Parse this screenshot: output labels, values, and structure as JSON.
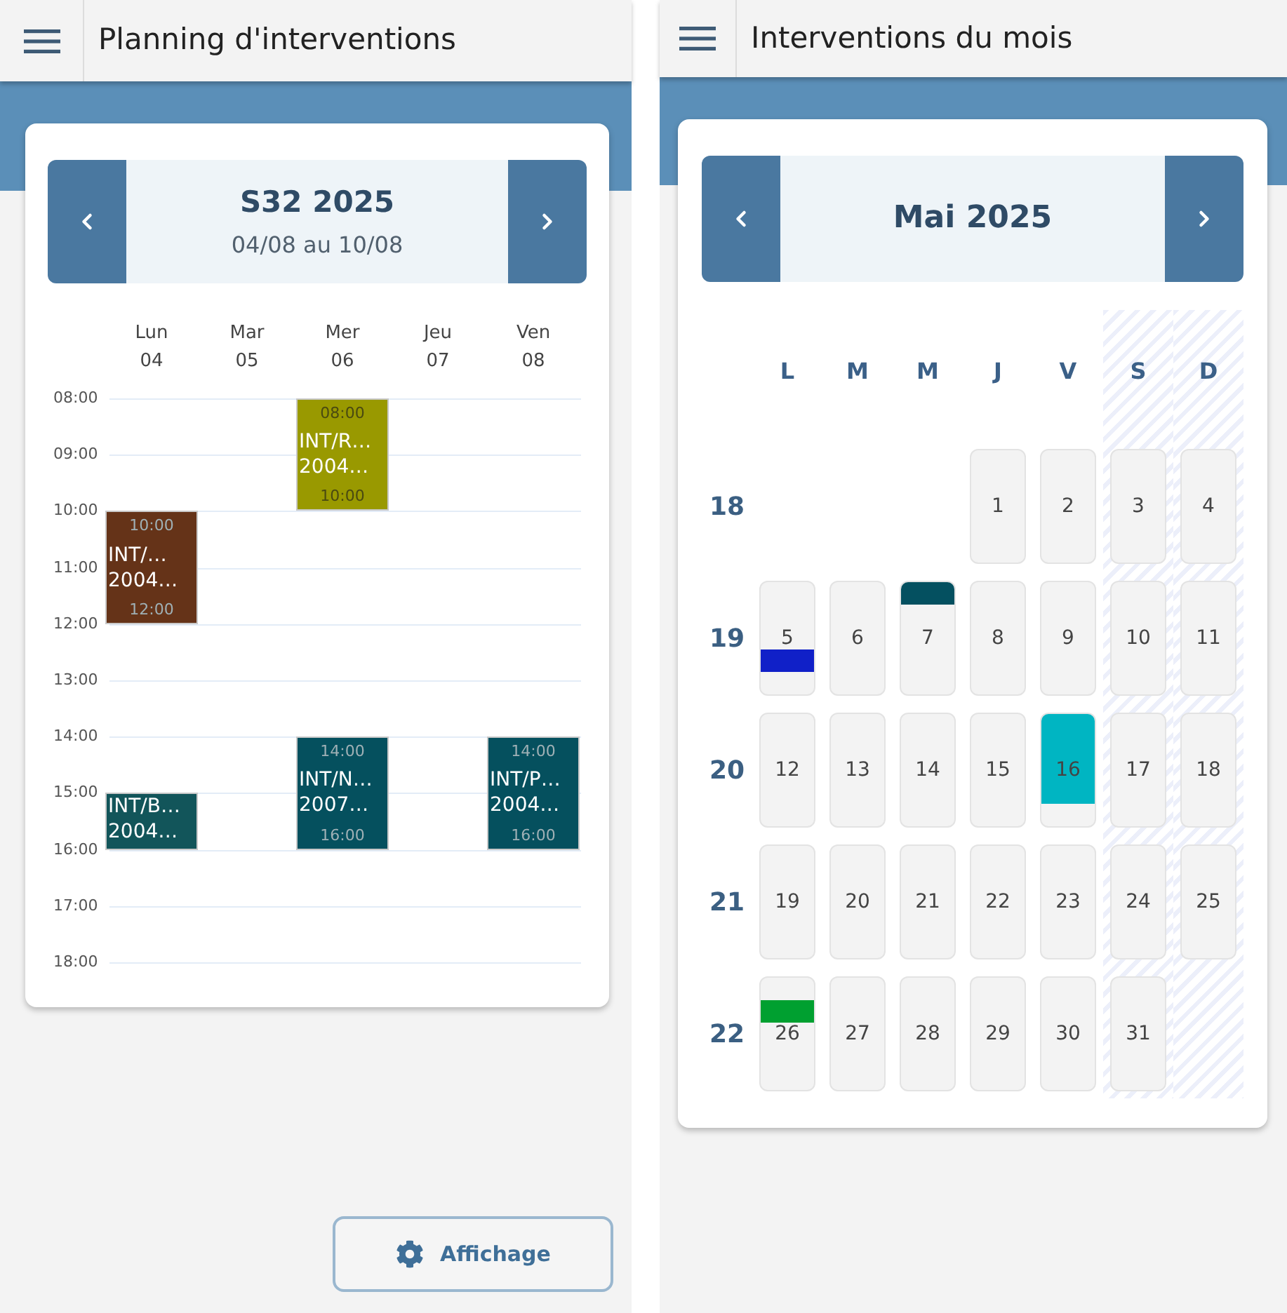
{
  "week_planning": {
    "header": {
      "title": "Planning d'interventions"
    },
    "navigation": {
      "title": "S32 2025",
      "subtitle": "04/08 au 10/08"
    },
    "hours": [
      "08:00",
      "09:00",
      "10:00",
      "11:00",
      "12:00",
      "13:00",
      "14:00",
      "15:00",
      "16:00",
      "17:00",
      "18:00"
    ],
    "days": [
      {
        "name": "Lun",
        "date": "04",
        "slots": [
          {
            "kind": "free"
          },
          {
            "kind": "free"
          },
          {
            "kind": "event",
            "start": "10:00",
            "title": "INT/…",
            "code": "2004…",
            "end": "12:00",
            "color": "#653318"
          },
          {
            "kind": "continued"
          },
          {
            "kind": "free"
          },
          {
            "kind": "free"
          },
          {
            "kind": "free"
          },
          {
            "kind": "event",
            "title": "INT/B…",
            "code": "2004…",
            "color": "#12555a"
          },
          {
            "kind": "free"
          },
          {
            "kind": "free"
          }
        ]
      },
      {
        "name": "Mar",
        "date": "05",
        "slots": [
          {
            "kind": "free"
          },
          {
            "kind": "free"
          },
          {
            "kind": "free"
          },
          {
            "kind": "free"
          },
          {
            "kind": "free"
          },
          {
            "kind": "free"
          },
          {
            "kind": "free"
          },
          {
            "kind": "free"
          },
          {
            "kind": "free"
          },
          {
            "kind": "free"
          }
        ]
      },
      {
        "name": "Mer",
        "date": "06",
        "slots": [
          {
            "kind": "event",
            "start": "08:00",
            "title": "INT/R…",
            "code": "2004…",
            "end": "10:00",
            "color": "#999900"
          },
          {
            "kind": "continued"
          },
          {
            "kind": "free"
          },
          {
            "kind": "free"
          },
          {
            "kind": "free"
          },
          {
            "kind": "free"
          },
          {
            "kind": "event",
            "start": "14:00",
            "title": "INT/N…",
            "code": "2007…",
            "end": "16:00",
            "color": "#05505e"
          },
          {
            "kind": "continued"
          },
          {
            "kind": "free"
          },
          {
            "kind": "free"
          }
        ]
      },
      {
        "name": "Jeu",
        "date": "07",
        "slots": [
          {
            "kind": "free"
          },
          {
            "kind": "free"
          },
          {
            "kind": "free"
          },
          {
            "kind": "free"
          },
          {
            "kind": "free"
          },
          {
            "kind": "free"
          },
          {
            "kind": "free"
          },
          {
            "kind": "free"
          },
          {
            "kind": "free"
          },
          {
            "kind": "free"
          }
        ]
      },
      {
        "name": "Ven",
        "date": "08",
        "slots": [
          {
            "kind": "free"
          },
          {
            "kind": "free"
          },
          {
            "kind": "free"
          },
          {
            "kind": "free"
          },
          {
            "kind": "free"
          },
          {
            "kind": "free"
          },
          {
            "kind": "event",
            "start": "14:00",
            "title": "INT/P…",
            "code": "2004…",
            "end": "16:00",
            "color": "#05505e"
          },
          {
            "kind": "continued"
          },
          {
            "kind": "free"
          },
          {
            "kind": "free"
          }
        ]
      }
    ],
    "display_button": {
      "label": "Affichage"
    }
  },
  "month_calendar": {
    "header": {
      "title": "Interventions du mois"
    },
    "navigation": {
      "title": "Mai 2025"
    },
    "weekdays": [
      {
        "label": "L",
        "weekend": false
      },
      {
        "label": "M",
        "weekend": false
      },
      {
        "label": "M",
        "weekend": false
      },
      {
        "label": "J",
        "weekend": false
      },
      {
        "label": "V",
        "weekend": false
      },
      {
        "label": "S",
        "weekend": true
      },
      {
        "label": "D",
        "weekend": true
      }
    ],
    "weeks": [
      {
        "number": "18",
        "days": [
          {
            "kind": "empty"
          },
          {
            "kind": "empty"
          },
          {
            "kind": "empty"
          },
          {
            "kind": "day",
            "label": "1"
          },
          {
            "kind": "day",
            "label": "2"
          },
          {
            "kind": "day",
            "label": "3"
          },
          {
            "kind": "day",
            "label": "4"
          }
        ]
      },
      {
        "number": "19",
        "days": [
          {
            "kind": "day",
            "label": "5",
            "events": [
              {
                "kind": "fourth",
                "color": "#1020c8"
              }
            ]
          },
          {
            "kind": "day",
            "label": "6"
          },
          {
            "kind": "day",
            "label": "7",
            "events": [
              {
                "kind": "top",
                "color": "#045060"
              }
            ]
          },
          {
            "kind": "day",
            "label": "8"
          },
          {
            "kind": "day",
            "label": "9"
          },
          {
            "kind": "day",
            "label": "10"
          },
          {
            "kind": "day",
            "label": "11"
          }
        ]
      },
      {
        "number": "20",
        "days": [
          {
            "kind": "day",
            "label": "12"
          },
          {
            "kind": "day",
            "label": "13"
          },
          {
            "kind": "day",
            "label": "14"
          },
          {
            "kind": "day",
            "label": "15"
          },
          {
            "kind": "day",
            "label": "16",
            "events": [
              {
                "kind": "tall",
                "color": "#00b5c2"
              }
            ]
          },
          {
            "kind": "day",
            "label": "17"
          },
          {
            "kind": "day",
            "label": "18"
          }
        ]
      },
      {
        "number": "21",
        "days": [
          {
            "kind": "day",
            "label": "19"
          },
          {
            "kind": "day",
            "label": "20"
          },
          {
            "kind": "day",
            "label": "21"
          },
          {
            "kind": "day",
            "label": "22"
          },
          {
            "kind": "day",
            "label": "23"
          },
          {
            "kind": "day",
            "label": "24"
          },
          {
            "kind": "day",
            "label": "25"
          }
        ]
      },
      {
        "number": "22",
        "days": [
          {
            "kind": "day",
            "label": "26",
            "events": [
              {
                "kind": "second",
                "color": "#00a030"
              }
            ]
          },
          {
            "kind": "day",
            "label": "27"
          },
          {
            "kind": "day",
            "label": "28"
          },
          {
            "kind": "day",
            "label": "29"
          },
          {
            "kind": "day",
            "label": "30"
          },
          {
            "kind": "day",
            "label": "31"
          },
          {
            "kind": "empty"
          }
        ]
      }
    ]
  }
}
